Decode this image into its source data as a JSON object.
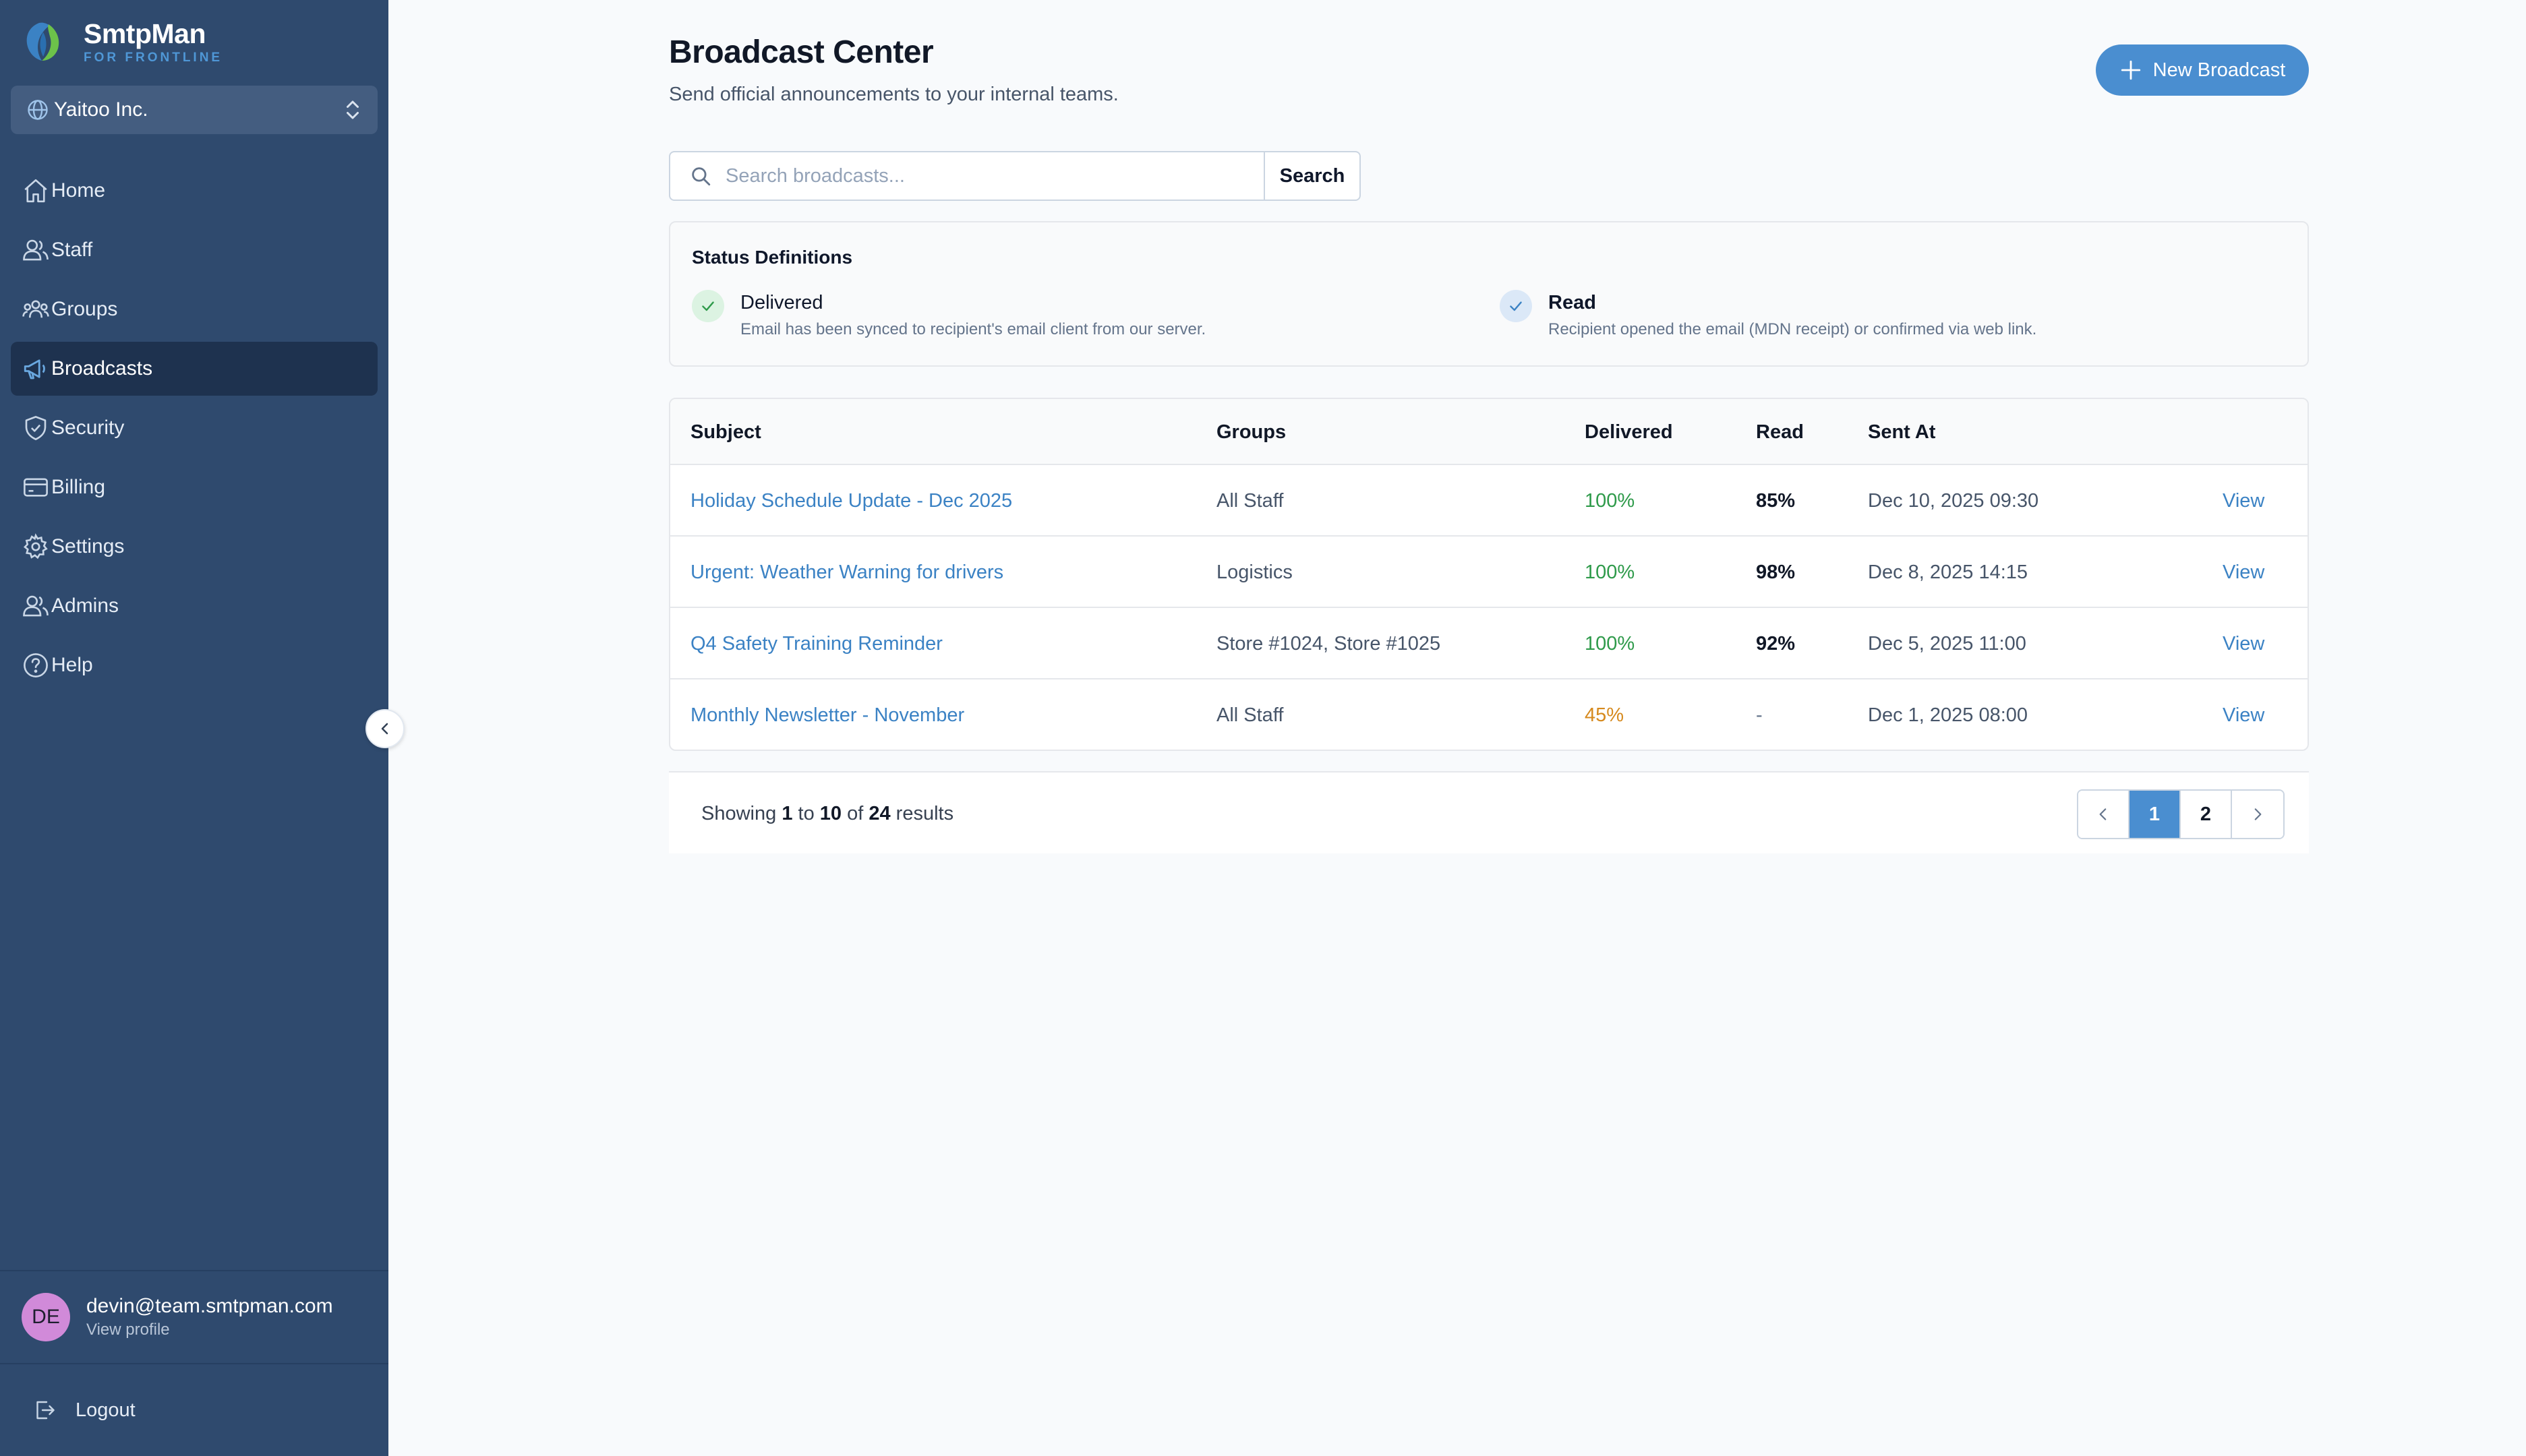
{
  "brand": {
    "name": "SmtpMan",
    "subtitle": "FOR FRONTLINE"
  },
  "org": {
    "name": "Yaitoo Inc."
  },
  "nav": [
    {
      "label": "Home",
      "icon": "home-icon",
      "active": false
    },
    {
      "label": "Staff",
      "icon": "users-icon",
      "active": false
    },
    {
      "label": "Groups",
      "icon": "groups-icon",
      "active": false
    },
    {
      "label": "Broadcasts",
      "icon": "megaphone-icon",
      "active": true
    },
    {
      "label": "Security",
      "icon": "shield-check-icon",
      "active": false
    },
    {
      "label": "Billing",
      "icon": "credit-card-icon",
      "active": false
    },
    {
      "label": "Settings",
      "icon": "gear-icon",
      "active": false
    },
    {
      "label": "Admins",
      "icon": "users-icon",
      "active": false
    },
    {
      "label": "Help",
      "icon": "help-circle-icon",
      "active": false
    }
  ],
  "user": {
    "initials": "DE",
    "email": "devin@team.smtpman.com",
    "profile_link": "View profile"
  },
  "logout_label": "Logout",
  "page": {
    "title": "Broadcast Center",
    "subtitle": "Send official announcements to your internal teams.",
    "new_button": "New Broadcast"
  },
  "search": {
    "placeholder": "Search broadcasts...",
    "value": "",
    "button": "Search"
  },
  "status_definitions": {
    "title": "Status Definitions",
    "items": [
      {
        "name": "Delivered",
        "description": "Email has been synced to recipient's email client from our server."
      },
      {
        "name": "Read",
        "description": "Recipient opened the email (MDN receipt) or confirmed via web link."
      }
    ]
  },
  "table": {
    "headers": {
      "subject": "Subject",
      "groups": "Groups",
      "delivered": "Delivered",
      "read": "Read",
      "sent_at": "Sent At"
    },
    "rows": [
      {
        "subject": "Holiday Schedule Update - Dec 2025",
        "groups": "All Staff",
        "delivered": "100%",
        "read": "85%",
        "sent_at": "Dec 10, 2025 09:30",
        "action": "View"
      },
      {
        "subject": "Urgent: Weather Warning for drivers",
        "groups": "Logistics",
        "delivered": "100%",
        "read": "98%",
        "sent_at": "Dec 8, 2025 14:15",
        "action": "View"
      },
      {
        "subject": "Q4 Safety Training Reminder",
        "groups": "Store #1024, Store #1025",
        "delivered": "100%",
        "read": "92%",
        "sent_at": "Dec 5, 2025 11:00",
        "action": "View"
      },
      {
        "subject": "Monthly Newsletter - November",
        "groups": "All Staff",
        "delivered": "45%",
        "read": "-",
        "sent_at": "Dec 1, 2025 08:00",
        "action": "View"
      }
    ]
  },
  "pagination": {
    "showing": "Showing",
    "from": "1",
    "to_word": "to",
    "to": "10",
    "of_word": "of",
    "total": "24",
    "results_word": "results",
    "pages": [
      "1",
      "2"
    ],
    "current": "1"
  },
  "colors": {
    "sidebar": "#2f4a6e",
    "accent": "#4a8ed0",
    "success": "#2e9a4a",
    "warning": "#d68a1e"
  }
}
